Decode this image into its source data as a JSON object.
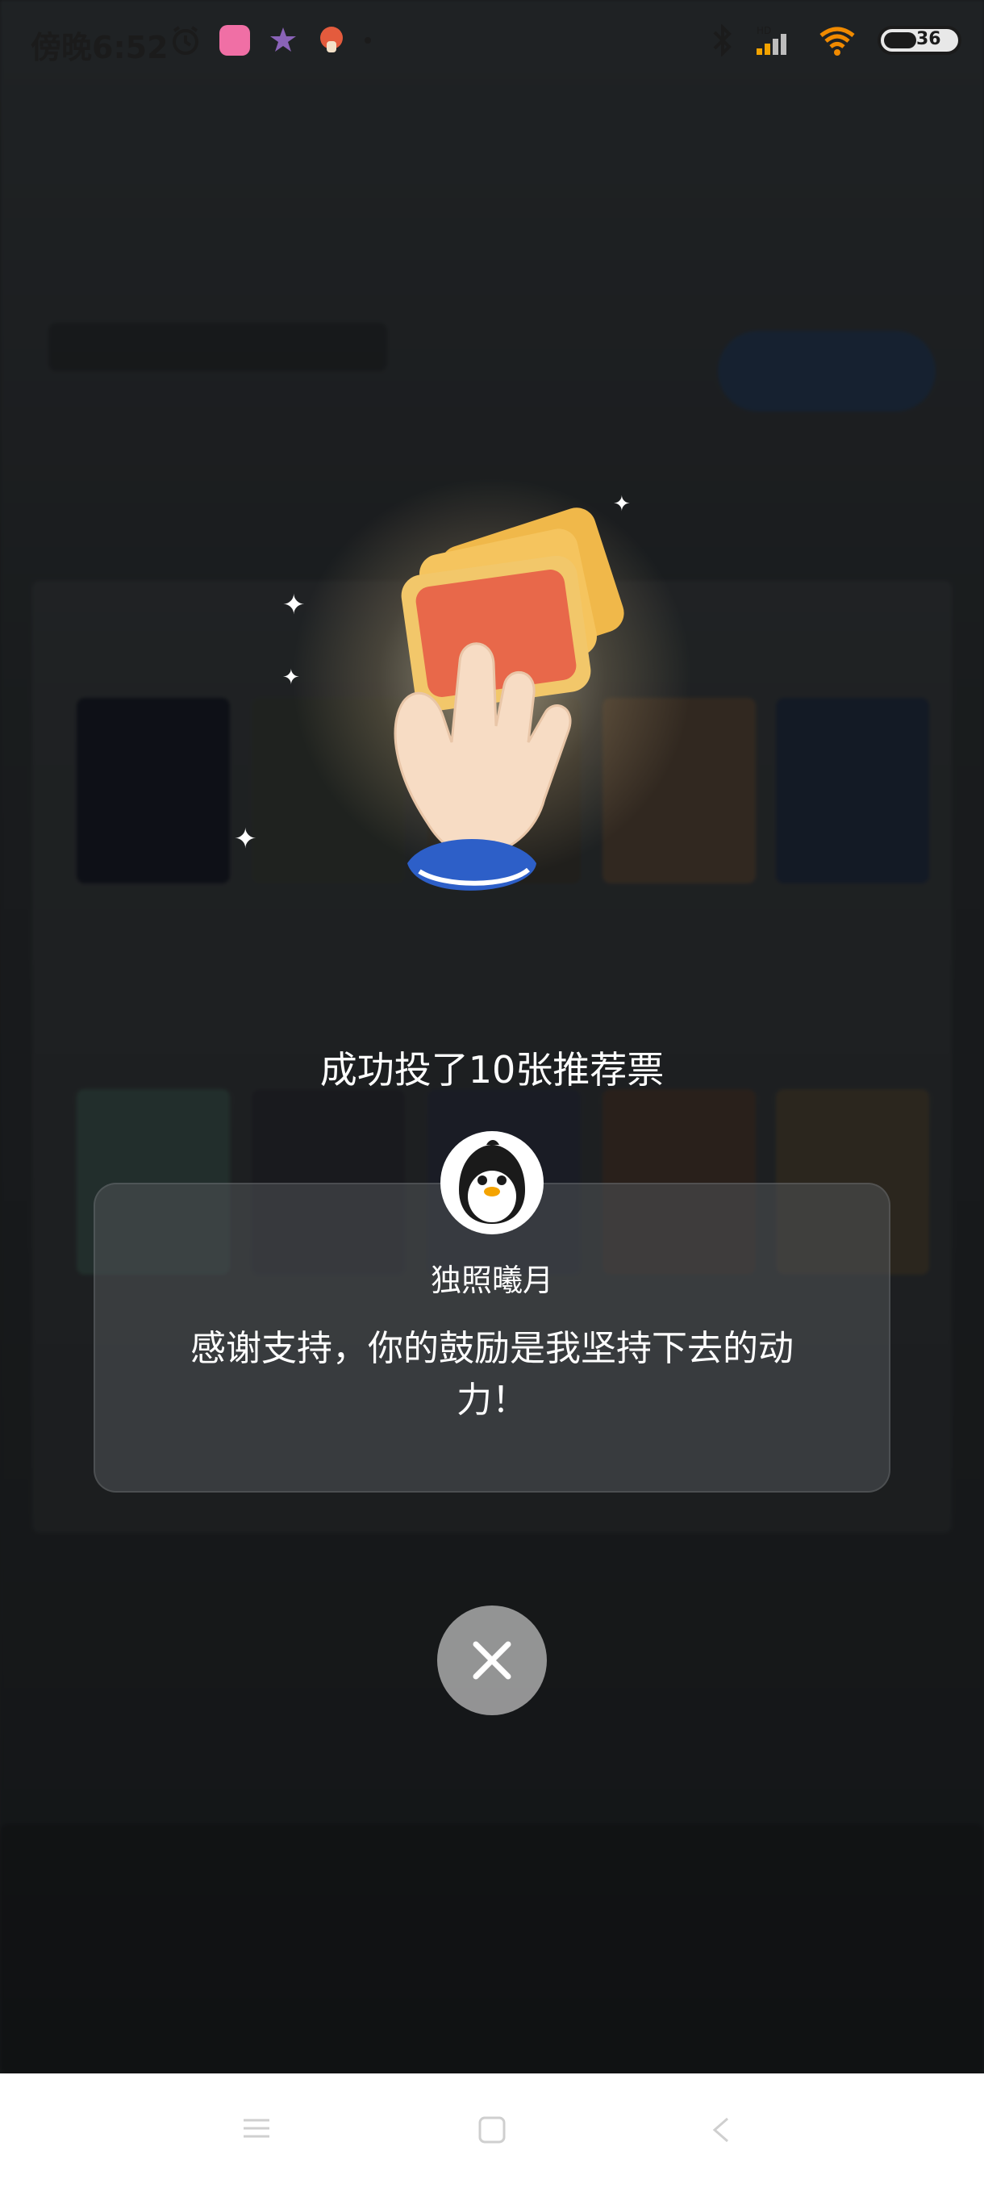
{
  "status_bar": {
    "time": "傍晚6:52",
    "icons": [
      "alarm-icon",
      "app-pink-icon",
      "app-star-icon",
      "app-mushroom-icon",
      "dot-icon"
    ],
    "right_icons": [
      "bluetooth-icon",
      "signal-hd-icon",
      "wifi-icon",
      "battery-icon"
    ],
    "battery_level": "36"
  },
  "dialog": {
    "title": "成功投了10张推荐票",
    "author_name": "独照曦月",
    "message": "感谢支持，你的鼓励是我坚持下去的动力！"
  },
  "nav_bar": {
    "items": [
      "menu-icon",
      "home-icon",
      "back-icon"
    ]
  },
  "colors": {
    "scrim": "#00000073",
    "text": "#ffffff",
    "close_button": "#bebebe",
    "nav_bg": "#ffffff"
  }
}
